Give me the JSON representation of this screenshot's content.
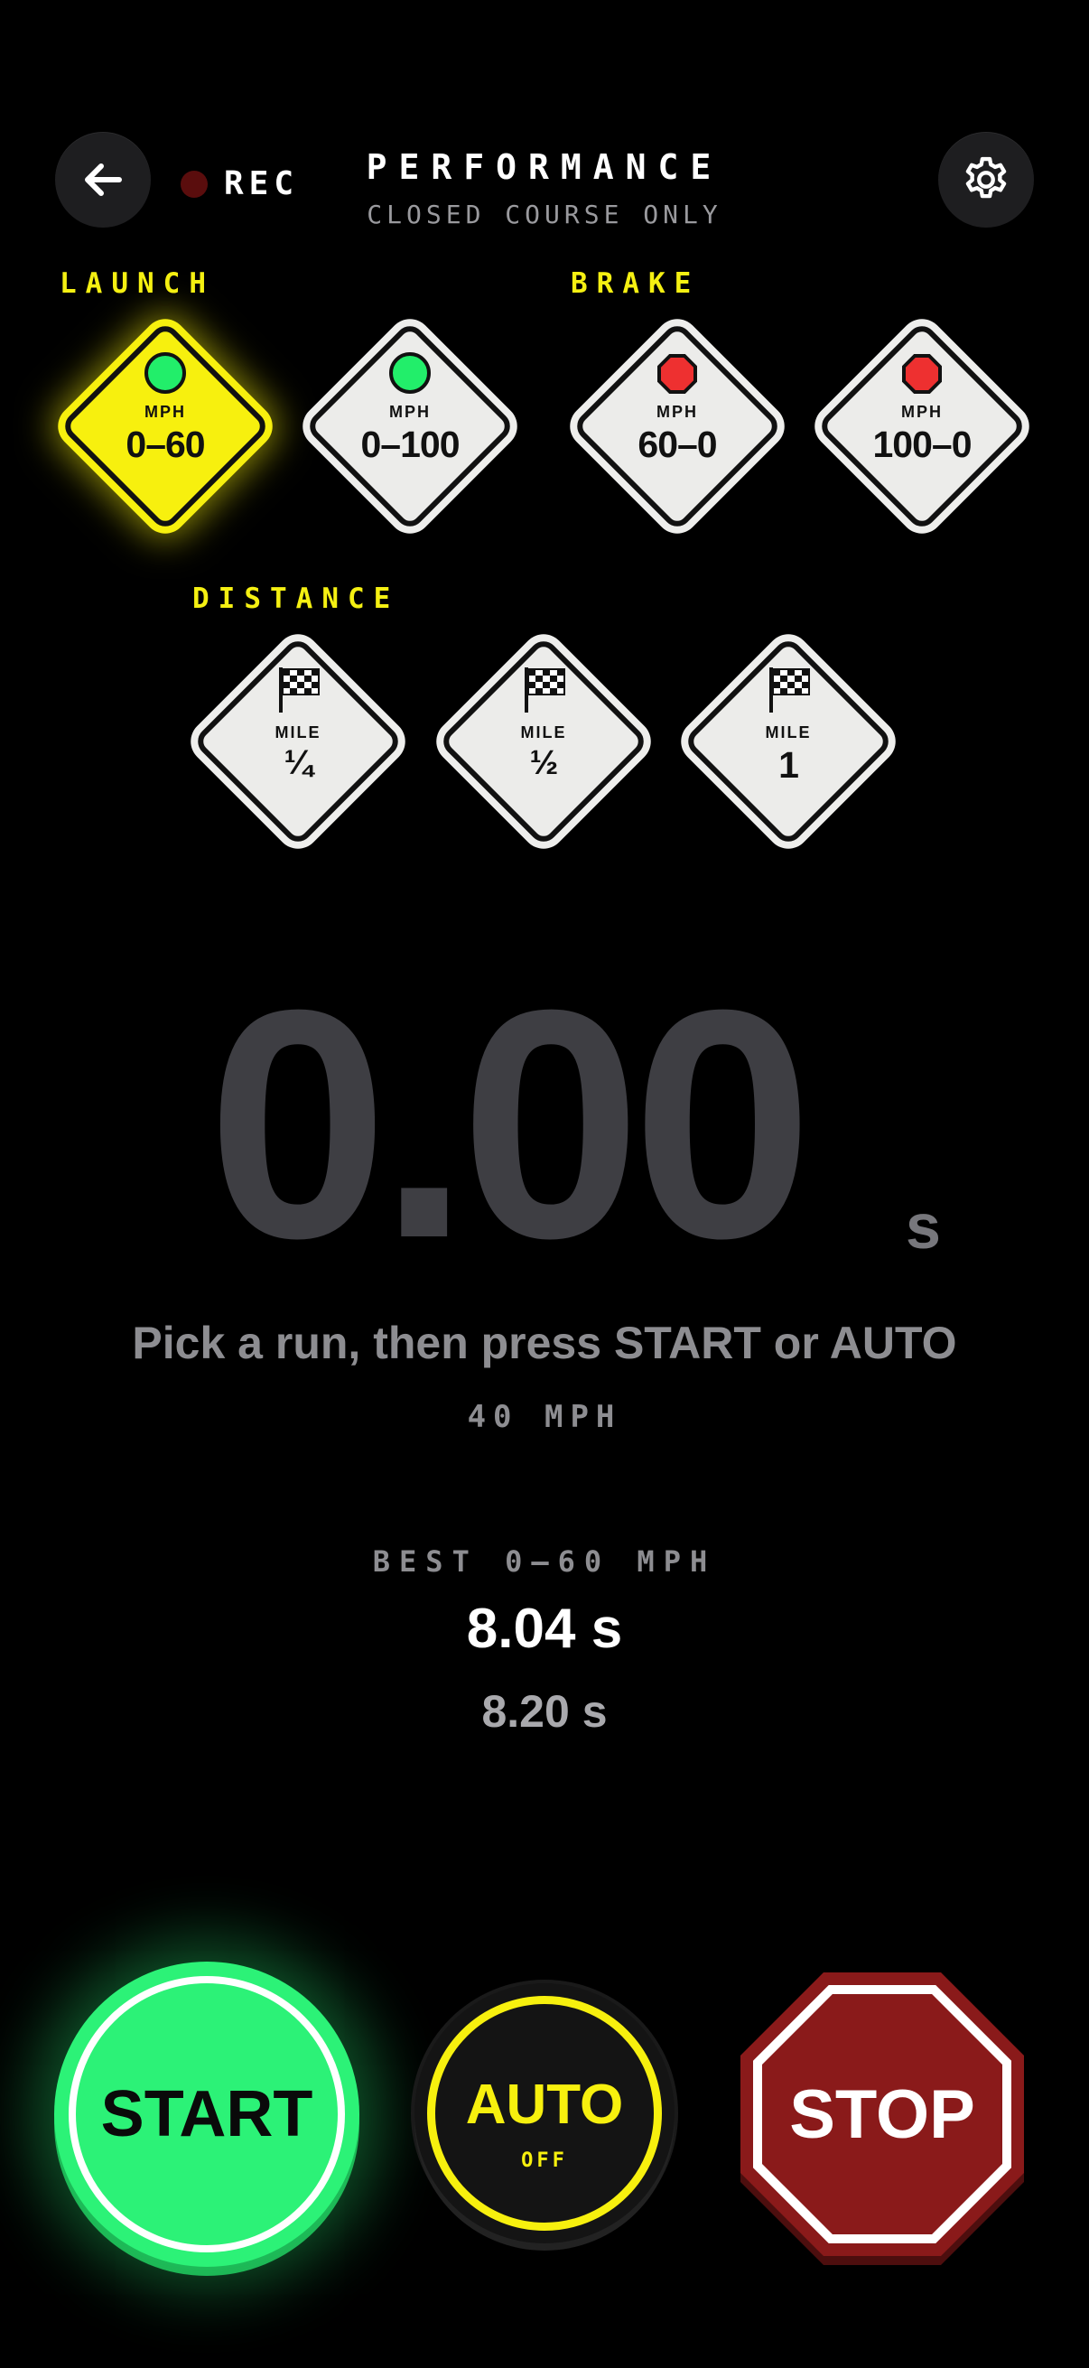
{
  "header": {
    "title": "PERFORMANCE",
    "subtitle": "CLOSED COURSE ONLY",
    "rec_label": "REC",
    "back_icon": "arrow-left-icon",
    "settings_icon": "gear-icon"
  },
  "sections": {
    "launch": "LAUNCH",
    "brake": "BRAKE",
    "distance": "DISTANCE"
  },
  "launch": [
    {
      "unit": "MPH",
      "value": "0–60",
      "icon": "green-light-icon",
      "selected": true
    },
    {
      "unit": "MPH",
      "value": "0–100",
      "icon": "green-light-icon",
      "selected": false
    }
  ],
  "brake": [
    {
      "unit": "MPH",
      "value": "60–0",
      "icon": "stop-sign-icon",
      "selected": false
    },
    {
      "unit": "MPH",
      "value": "100–0",
      "icon": "stop-sign-icon",
      "selected": false
    }
  ],
  "distance": [
    {
      "unit": "MILE",
      "value": "¼",
      "icon": "checkered-flag-icon",
      "selected": false
    },
    {
      "unit": "MILE",
      "value": "½",
      "icon": "checkered-flag-icon",
      "selected": false
    },
    {
      "unit": "MILE",
      "value": "1",
      "icon": "checkered-flag-icon",
      "selected": false
    }
  ],
  "timer": {
    "value": "0.00",
    "unit": "s"
  },
  "hint": "Pick a run, then press START or AUTO",
  "target_speed": "40 MPH",
  "best": {
    "label": "BEST 0–60 MPH",
    "value": "8.04 s",
    "previous": "8.20 s"
  },
  "controls": {
    "start": "START",
    "auto": "AUTO",
    "auto_state": "OFF",
    "stop": "STOP"
  },
  "colors": {
    "accent_yellow": "#f7f00e",
    "go_green": "#2cf277",
    "stop_red": "#8a1a1a",
    "background": "#000000"
  }
}
